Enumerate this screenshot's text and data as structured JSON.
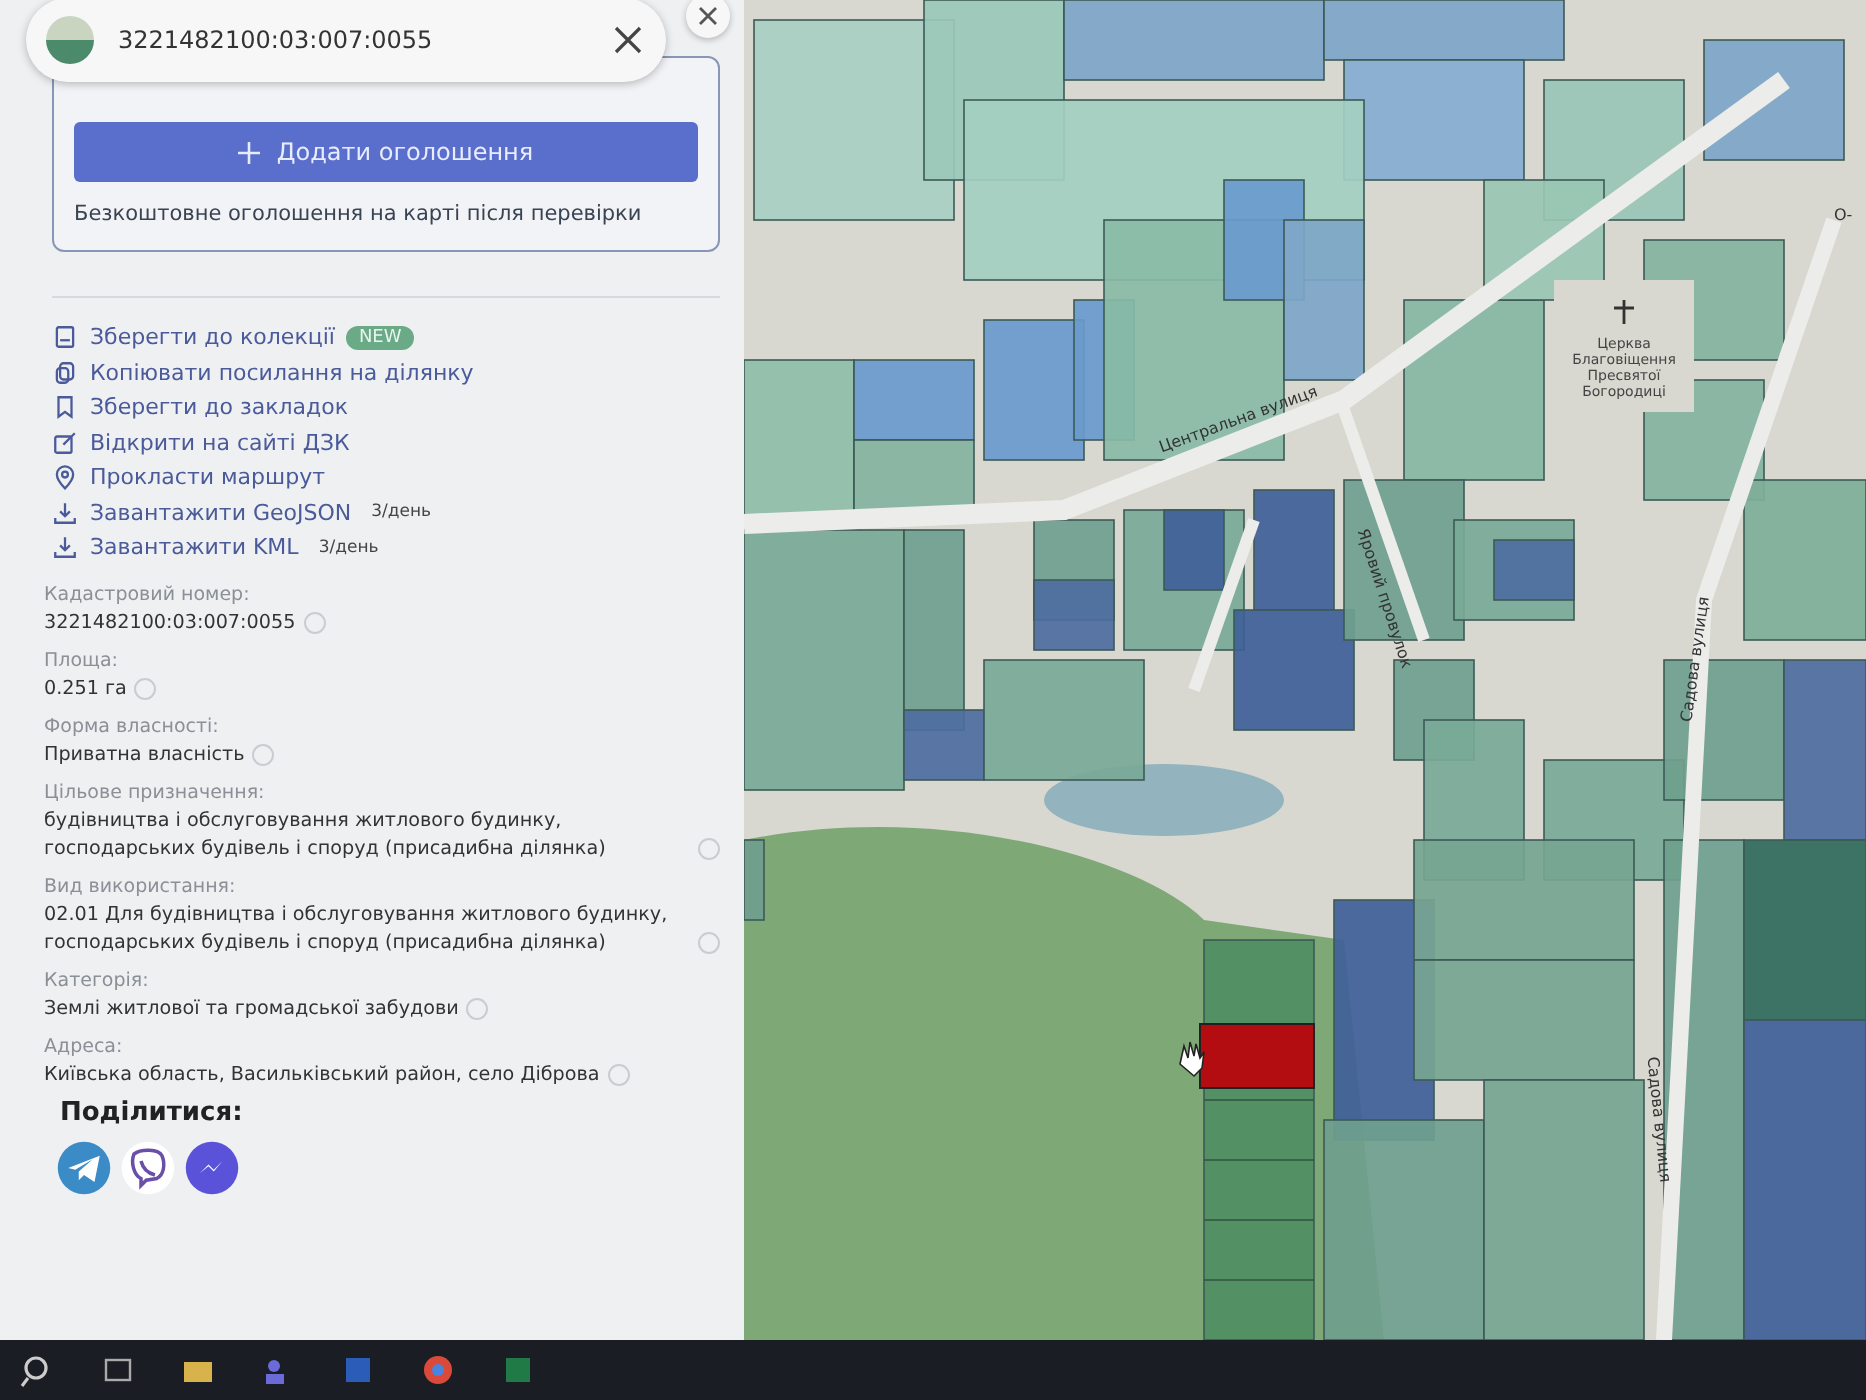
{
  "search": {
    "value": "3221482100:03:007:0055"
  },
  "add_listing": {
    "button": "Додати оголошення",
    "note": "Безкоштовне оголошення на карті після перевірки"
  },
  "actions": [
    {
      "kind": "collection",
      "label": "Зберегти до колекції",
      "badge": "NEW"
    },
    {
      "kind": "copy",
      "label": "Копіювати посилання на ділянку"
    },
    {
      "kind": "bookmark",
      "label": "Зберегти до закладок"
    },
    {
      "kind": "external",
      "label": "Відкрити на сайті ДЗК"
    },
    {
      "kind": "route",
      "label": "Прокласти маршрут"
    },
    {
      "kind": "download",
      "label": "Завантажити GeoJSON",
      "limit": "3/день"
    },
    {
      "kind": "download",
      "label": "Завантажити KML",
      "limit": "3/день"
    }
  ],
  "details": [
    {
      "label": "Кадастровий номер:",
      "value": "3221482100:03:007:0055"
    },
    {
      "label": "Площа:",
      "value": "0.251 га"
    },
    {
      "label": "Форма власності:",
      "value": "Приватна власність"
    },
    {
      "label": "Цільове призначення:",
      "value": "будівництва і обслуговування житлового будинку, господарських будівель і споруд (присадибна ділянка)"
    },
    {
      "label": "Вид використання:",
      "value": "02.01 Для будівництва і обслуговування житлового будинку, господарських будівель і споруд (присадибна ділянка)"
    },
    {
      "label": "Категорія:",
      "value": "Землі житлової та громадської забудови"
    },
    {
      "label": "Адреса:",
      "value": "Київська область, Васильківський район, село Діброва"
    }
  ],
  "share": {
    "title": "Поділитися:",
    "networks": [
      {
        "kind": "telegram"
      },
      {
        "kind": "viber"
      },
      {
        "kind": "messenger"
      }
    ]
  },
  "map": {
    "streets": [
      "Центральна вулиця",
      "Яровий провулок",
      "Садова вулиця",
      "Садова вулиця"
    ],
    "place": {
      "lines": [
        "Церква",
        "Благовіщення",
        "Пресвятої",
        "Богородиці"
      ]
    },
    "corner_label": "О-"
  }
}
